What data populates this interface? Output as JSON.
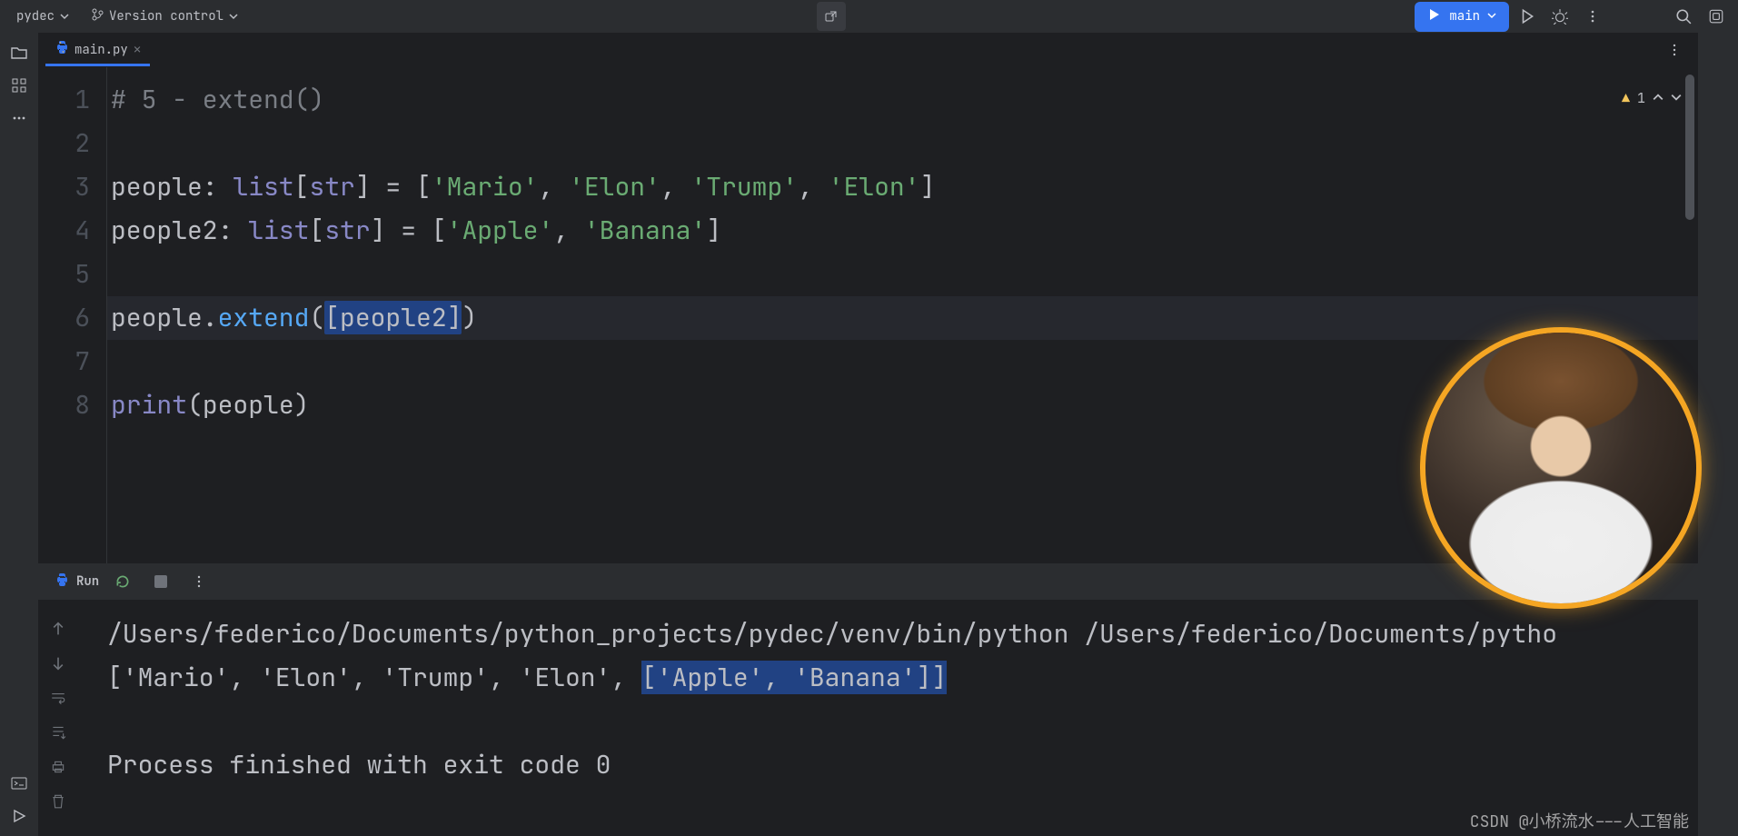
{
  "header": {
    "project": "pydec",
    "vcs": "Version control",
    "run_config": "main"
  },
  "tabs": {
    "active": "main.py"
  },
  "inspection": {
    "warning_count": "1"
  },
  "editor": {
    "lines": [
      "1",
      "2",
      "3",
      "4",
      "5",
      "6",
      "7",
      "8"
    ],
    "l1_comment": "# 5 - extend()",
    "l3_a": "people: ",
    "l3_list": "list",
    "l3_b": "[",
    "l3_str": "str",
    "l3_c": "] = [",
    "l3_s1": "'Mario'",
    "l3_s2": "'Elon'",
    "l3_s3": "'Trump'",
    "l3_s4": "'Elon'",
    "l3_d": "]",
    "l4_a": "people2: ",
    "l4_list": "list",
    "l4_b": "[",
    "l4_str": "str",
    "l4_c": "] = [",
    "l4_s1": "'Apple'",
    "l4_s2": "'Banana'",
    "l4_d": "]",
    "l6_a": "people.",
    "l6_ext": "extend",
    "l6_b": "(",
    "l6_sel": "[people2]",
    "l6_c": ")",
    "l8_print": "print",
    "l8_b": "(people)"
  },
  "run": {
    "label": "Run",
    "out_path": "/Users/federico/Documents/python_projects/pydec/venv/bin/python /Users/federico/Documents/pytho",
    "out_list_a": "['Mario', 'Elon', 'Trump', 'Elon', ",
    "out_list_hl": "['Apple', 'Banana']]",
    "out_exit": "Process finished with exit code 0"
  },
  "watermark": "CSDN @小桥流水---人工智能"
}
